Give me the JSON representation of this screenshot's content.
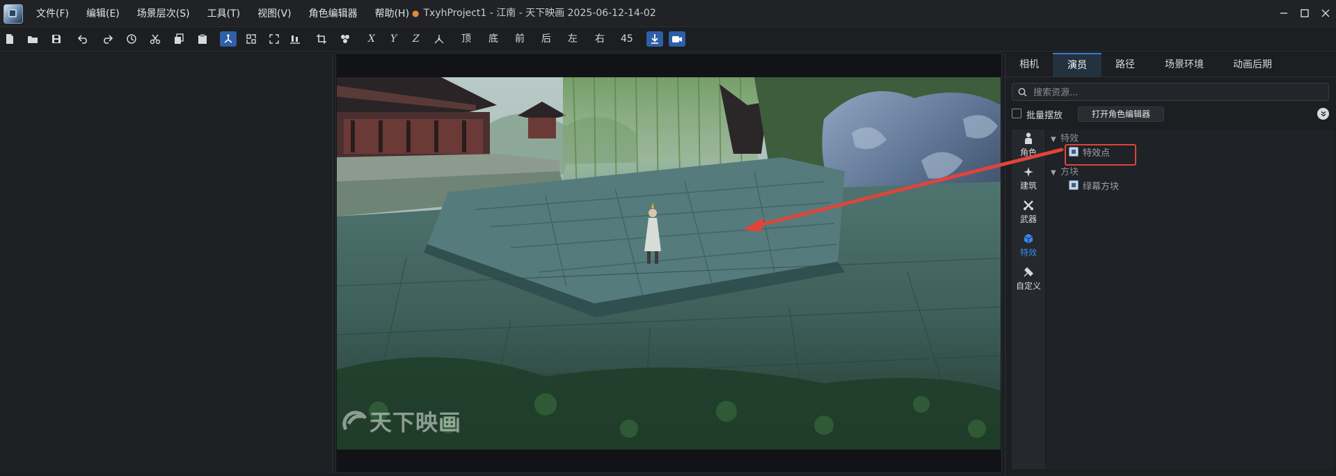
{
  "app": {
    "logo_icon": "app-logo",
    "document_title": "TxyhProject1 - 江南 - 天下映画 2025-06-12-14-02",
    "unsaved_indicator": "●"
  },
  "menu": {
    "items": [
      "文件(F)",
      "编辑(E)",
      "场景层次(S)",
      "工具(T)",
      "视图(V)",
      "角色编辑器",
      "帮助(H)"
    ]
  },
  "toolbar": {
    "axis_x": "X",
    "axis_y": "Y",
    "axis_z": "Z",
    "views": [
      "顶",
      "底",
      "前",
      "后",
      "左",
      "右",
      "45"
    ],
    "icons": [
      "new-file-icon",
      "open-folder-icon",
      "save-icon",
      "undo-icon",
      "redo-icon",
      "history-icon",
      "cut-icon",
      "copy-icon",
      "paste-icon",
      "move-gizmo-icon",
      "scale-gizmo-icon",
      "fit-view-icon",
      "ground-align-icon",
      "crop-icon",
      "group-icon",
      "axis-free-icon",
      "drop-to-ground-icon",
      "camera-icon"
    ],
    "accent": "#2e5fa8"
  },
  "viewport": {
    "watermark": "天下映画"
  },
  "right_panel": {
    "tabs": [
      "相机",
      "演员",
      "路径",
      "场景环境",
      "动画后期"
    ],
    "active_tab": "演员",
    "search": {
      "placeholder": "搜索资源...",
      "value": ""
    },
    "batch_place_label": "批量摆放",
    "open_role_editor_label": "打开角色编辑器",
    "categories": [
      {
        "label": "角色",
        "icon": "character-icon"
      },
      {
        "label": "建筑",
        "icon": "building-icon"
      },
      {
        "label": "武器",
        "icon": "weapon-icon"
      },
      {
        "label": "特效",
        "icon": "effect-cube-icon"
      },
      {
        "label": "自定义",
        "icon": "custom-icon"
      }
    ],
    "active_category": "特效",
    "active_color": "#3b86f0",
    "tree": {
      "group1": {
        "label": "特效",
        "items": [
          "特效点"
        ]
      },
      "group2": {
        "label": "方块",
        "items": [
          "绿幕方块"
        ]
      }
    }
  },
  "annotation": {
    "highlight_color": "#e0443a"
  }
}
